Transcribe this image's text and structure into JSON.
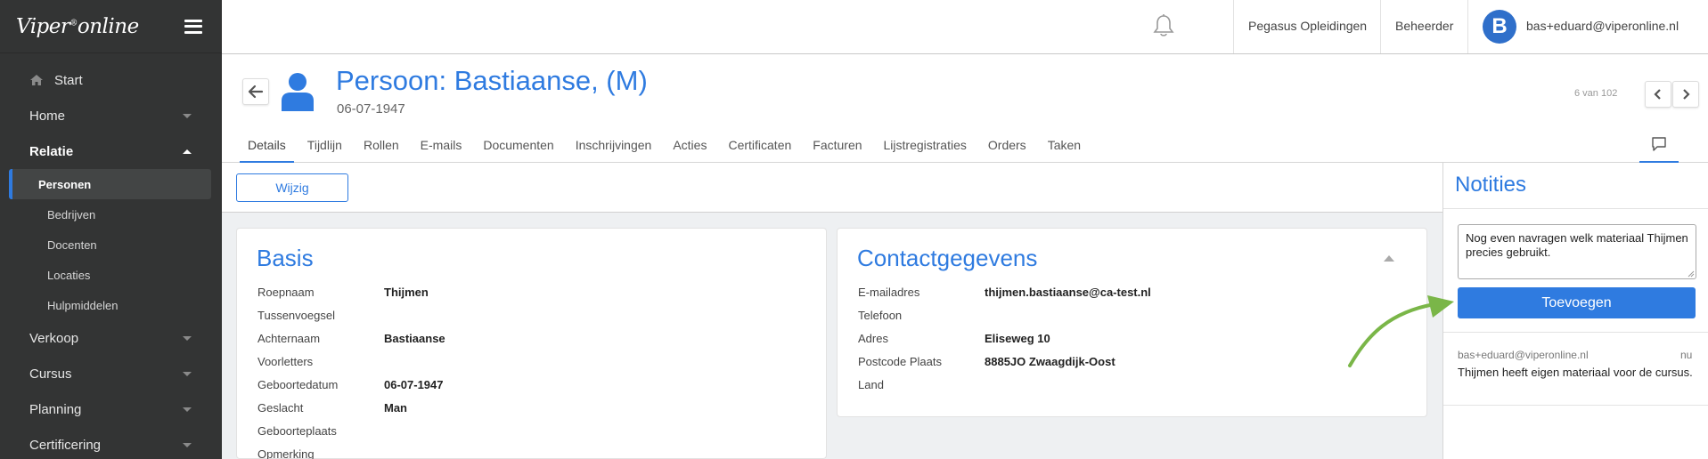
{
  "app": {
    "logo_text": "Viper",
    "logo_suffix": "online",
    "logo_mark": "®"
  },
  "sidebar": {
    "start_label": "Start",
    "items": [
      {
        "label": "Home"
      },
      {
        "label": "Relatie"
      },
      {
        "label": "Verkoop"
      },
      {
        "label": "Cursus"
      },
      {
        "label": "Planning"
      },
      {
        "label": "Certificering"
      }
    ],
    "sub_items": [
      {
        "label": "Personen"
      },
      {
        "label": "Bedrijven"
      },
      {
        "label": "Docenten"
      },
      {
        "label": "Locaties"
      },
      {
        "label": "Hulpmiddelen"
      }
    ]
  },
  "topbar": {
    "organization": "Pegasus Opleidingen",
    "role": "Beheerder",
    "avatar_initial": "B",
    "user_email": "bas+eduard@viperonline.nl"
  },
  "header": {
    "title": "Persoon: Bastiaanse, (M)",
    "subtitle": "06-07-1947",
    "pager_text": "6 van 102"
  },
  "tabs": [
    {
      "label": "Details"
    },
    {
      "label": "Tijdlijn"
    },
    {
      "label": "Rollen"
    },
    {
      "label": "E-mails"
    },
    {
      "label": "Documenten"
    },
    {
      "label": "Inschrijvingen"
    },
    {
      "label": "Acties"
    },
    {
      "label": "Certificaten"
    },
    {
      "label": "Facturen"
    },
    {
      "label": "Lijstregistraties"
    },
    {
      "label": "Orders"
    },
    {
      "label": "Taken"
    }
  ],
  "actions": {
    "edit_label": "Wijzig"
  },
  "basis": {
    "title": "Basis",
    "rows": [
      {
        "label": "Roepnaam",
        "value": "Thijmen"
      },
      {
        "label": "Tussenvoegsel",
        "value": ""
      },
      {
        "label": "Achternaam",
        "value": "Bastiaanse"
      },
      {
        "label": "Voorletters",
        "value": ""
      },
      {
        "label": "Geboortedatum",
        "value": "06-07-1947"
      },
      {
        "label": "Geslacht",
        "value": "Man"
      },
      {
        "label": "Geboorteplaats",
        "value": ""
      },
      {
        "label": "Opmerking",
        "value": ""
      }
    ]
  },
  "contact": {
    "title": "Contactgegevens",
    "rows": [
      {
        "label": "E-mailadres",
        "value": "thijmen.bastiaanse@ca-test.nl"
      },
      {
        "label": "Telefoon",
        "value": ""
      },
      {
        "label": "Adres",
        "value": "Eliseweg 10"
      },
      {
        "label": "Postcode Plaats",
        "value": "8885JO Zwaagdijk-Oost"
      },
      {
        "label": "Land",
        "value": ""
      }
    ]
  },
  "notes": {
    "title": "Notities",
    "input_value": "Nog even navragen welk materiaal Thijmen precies gebruikt.",
    "add_label": "Toevoegen",
    "entries": [
      {
        "author": "bas+eduard@viperonline.nl",
        "time": "nu",
        "text": "Thijmen heeft eigen materiaal voor de cursus."
      }
    ]
  },
  "colors": {
    "accent": "#2f7be0",
    "sidebar_bg": "#333434",
    "annotation_arrow": "#7ab648"
  }
}
